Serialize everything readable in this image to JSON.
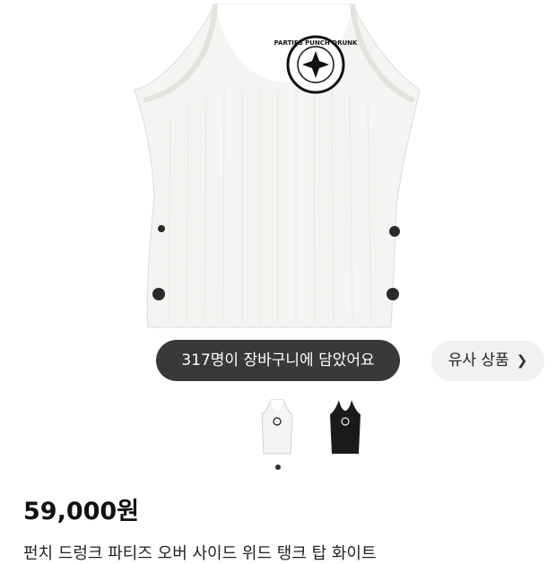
{
  "hero": {
    "cart_count_text": "317명이 장바구니에 담았어요",
    "similar_label": "유사 상품",
    "similar_chevron_icon": "chevron-right-icon",
    "logo_text": "PARTIES PUNCH DRUNK"
  },
  "thumbnails": [
    {
      "color": "white"
    },
    {
      "color": "black"
    }
  ],
  "carousel": {
    "active_index": 1,
    "total": 1
  },
  "product": {
    "price": "59,000원",
    "name": "펀치 드렁크 파티즈 오버 사이드 위드 탱크 탑 화이트"
  },
  "colors": {
    "pill_bg": "#282828",
    "similar_bg": "#f1f1f1"
  }
}
